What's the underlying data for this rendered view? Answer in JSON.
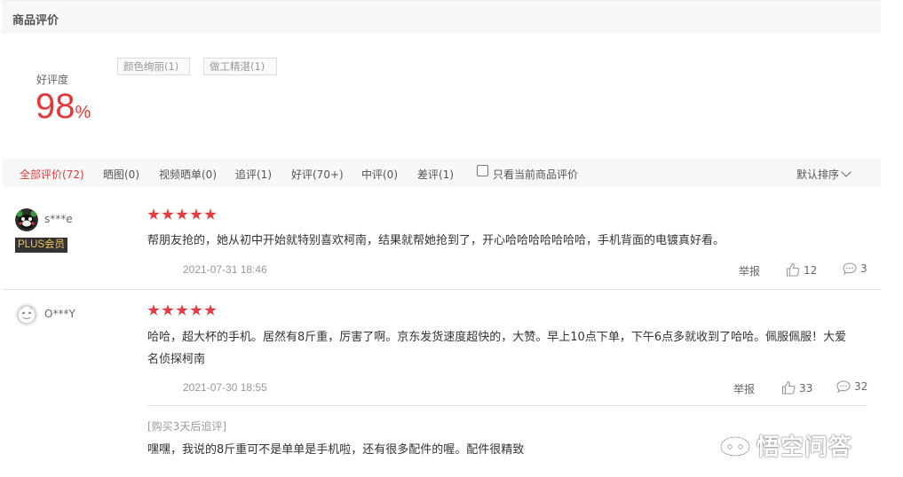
{
  "header": {
    "title": "商品评价"
  },
  "rating": {
    "label": "好评度",
    "value": "98",
    "unit": "%"
  },
  "tags": [
    "颜色绚丽(1)",
    "做工精湛(1)"
  ],
  "filters": [
    {
      "label": "全部评价(72)",
      "active": true
    },
    {
      "label": "晒图(0)"
    },
    {
      "label": "视频晒单(0)"
    },
    {
      "label": "追评(1)"
    },
    {
      "label": "好评(70+)"
    },
    {
      "label": "中评(0)"
    },
    {
      "label": "差评(1)"
    }
  ],
  "only_current": {
    "label": "只看当前商品评价",
    "checked": false
  },
  "sort": {
    "label": "默认排序"
  },
  "reviews": [
    {
      "username": "s***e",
      "badge": "PLUS会员",
      "stars": 5,
      "text": "帮朋友抢的，她从初中开始就特别喜欢柯南，结果就帮她抢到了，开心哈哈哈哈哈哈哈，手机背面的电镀真好看。",
      "date": "2021-07-31 18:46",
      "report": "举报",
      "likes": "12",
      "comments": "3"
    },
    {
      "username": "O***Y",
      "stars": 5,
      "text": "哈哈，超大杯的手机。居然有8斤重，厉害了啊。京东发货速度超快的，大赞。早上10点下单，下午6点多就收到了哈哈。佩服佩服！大爱名侦探柯南",
      "date": "2021-07-30 18:55",
      "report": "举报",
      "likes": "33",
      "comments": "32",
      "followup_label": "[购买3天后追评]",
      "followup_text": "嘿嘿，我说的8斤重可不是单单是手机啦，还有很多配件的喔。配件很精致"
    }
  ],
  "watermark": {
    "text": "悟空问答"
  },
  "colors": {
    "accent": "#e4393c",
    "muted": "#999999",
    "bar": "#f7f7f7"
  }
}
